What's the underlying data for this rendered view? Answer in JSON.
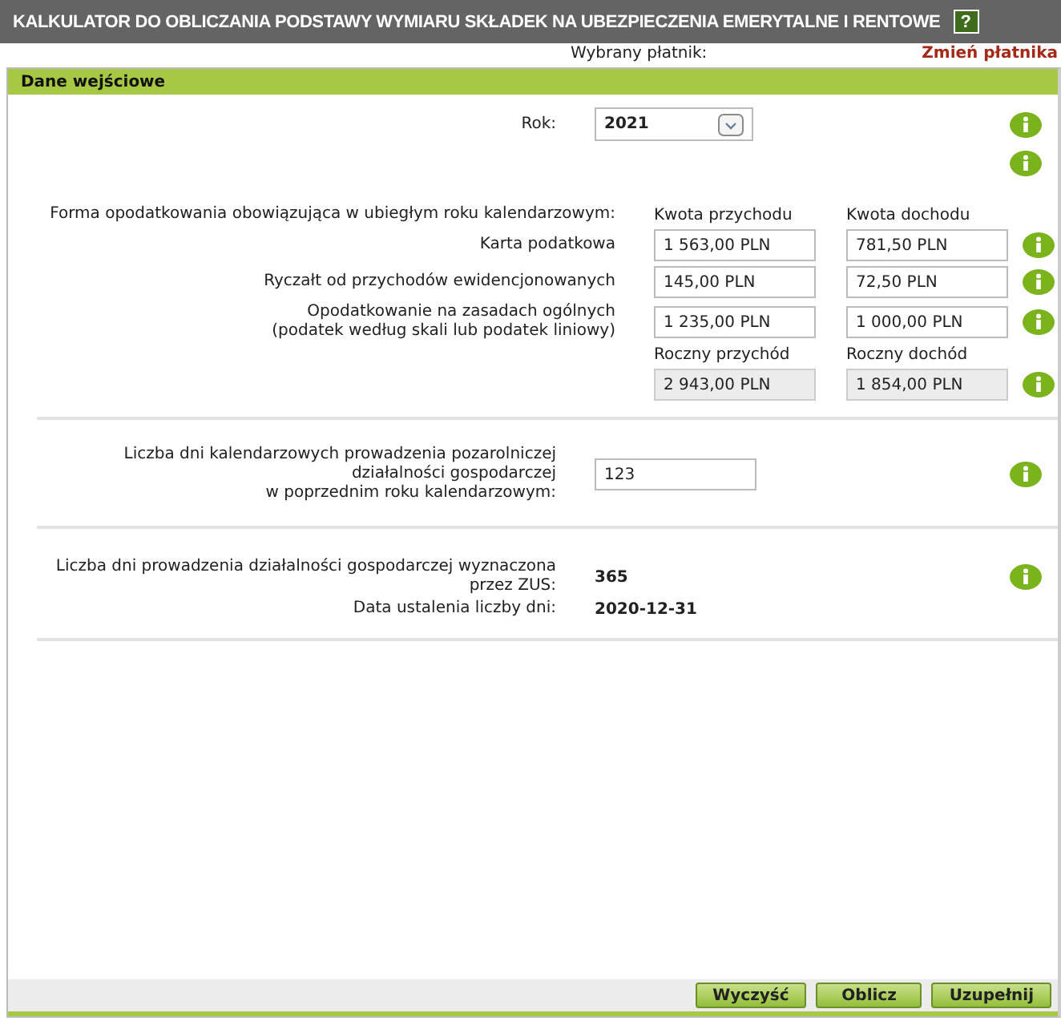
{
  "window": {
    "title": "KALKULATOR DO OBLICZANIA PODSTAWY WYMIARU SKŁADEK NA UBEZPIECZENIA EMERYTALNE I RENTOWE",
    "help": "?"
  },
  "payer": {
    "label": "Wybrany płatnik:",
    "link": "Zmień płatnika"
  },
  "panel": {
    "title": "Dane wejściowe"
  },
  "year": {
    "label": "Rok:",
    "value": "2021"
  },
  "tax": {
    "label": "Forma opodatkowania obowiązująca w ubiegłym roku kalendarzowym:",
    "col1": "Kwota przychodu",
    "col2": "Kwota dochodu",
    "rows": [
      {
        "label": "Karta podatkowa",
        "income": "1 563,00 PLN",
        "profit": "781,50 PLN"
      },
      {
        "label": "Ryczałt od przychodów ewidencjonowanych",
        "income": "145,00 PLN",
        "profit": "72,50 PLN"
      },
      {
        "label": "Opodatkowanie na zasadach ogólnych\n(podatek według skali lub podatek liniowy)",
        "income": "1 235,00 PLN",
        "profit": "1 000,00 PLN"
      }
    ],
    "total_col1": "Roczny przychód",
    "total_col2": "Roczny dochód",
    "total_income": "2 943,00 PLN",
    "total_profit": "1 854,00 PLN",
    "totals_disabled": true
  },
  "days": {
    "label": "Liczba dni kalendarzowych prowadzenia pozarolniczej\ndziałalności gospodarczej\nw poprzednim roku kalendarzowym:",
    "value": "123"
  },
  "zus": {
    "label": "Liczba dni prowadzenia działalności gospodarczej wyznaczona\nprzez ZUS:",
    "value": "365",
    "date_label": "Data ustalenia liczby dni:",
    "date": "2020-12-31"
  },
  "buttons": [
    "Wyczyść",
    "Oblicz",
    "Uzupełnij"
  ]
}
